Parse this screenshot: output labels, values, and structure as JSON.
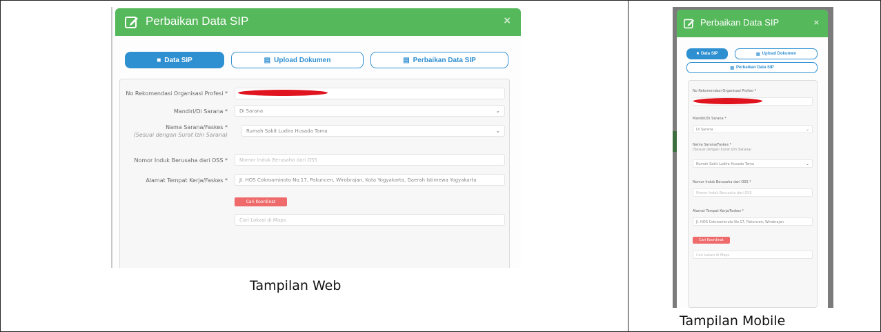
{
  "colors": {
    "header_green": "#55b85a",
    "tab_blue": "#2e8fd1",
    "map_button_red": "#ef6b6b",
    "redaction_red": "#e0141e"
  },
  "web": {
    "modal_title": "Perbaikan Data SIP",
    "close_icon": "×",
    "tabs": [
      {
        "label": "Data SIP",
        "icon": "user-icon",
        "active": true
      },
      {
        "label": "Upload Dokumen",
        "icon": "document-icon",
        "active": false
      },
      {
        "label": "Perbaikan Data SIP",
        "icon": "document-icon",
        "active": false
      }
    ],
    "fields": {
      "rekomendasi": {
        "label": "No Rekomendasi Organisasi Profesi *",
        "value": ""
      },
      "praktik": {
        "label": "Mandiri/Di Sarana *",
        "value": "Di Sarana"
      },
      "sarana": {
        "label": "Nama Sarana/Faskes *",
        "hint": "(Sesuai dengan Surat Izin Sarana)",
        "value": "Rumah Sakit Ludira Husada Tama"
      },
      "nib": {
        "label": "Nomor Induk Berusaha dari OSS *",
        "placeholder": "Nomor Induk Berusaha dari OSS"
      },
      "alamat": {
        "label": "Alamat Tempat Kerja/Faskes *",
        "value": "Jl. HOS Cokroaminoto No.17, Pakuncen, Wirobrajan, Kota Yogyakarta, Daerah Istimewa Yogyakarta"
      }
    },
    "map_button": "Cari Koordinat",
    "map_search_placeholder": "Cari Lokasi di Maps",
    "caption": "Tampilan Web"
  },
  "mobile": {
    "modal_title": "Perbaikan Data SIP",
    "close_icon": "×",
    "tabs": [
      {
        "label": "Data SIP",
        "icon": "user-icon",
        "active": true
      },
      {
        "label": "Upload Dokumen",
        "icon": "document-icon",
        "active": false
      },
      {
        "label": "Perbaikan Data SIP",
        "icon": "document-icon",
        "active": false
      }
    ],
    "fields": {
      "rekomendasi": {
        "label": "No Rekomendasi Organisasi Profesi *",
        "value": ""
      },
      "praktik": {
        "label": "Mandiri/Di Sarana *",
        "value": "Di Sarana"
      },
      "sarana": {
        "label": "Nama Sarana/Faskes *",
        "hint": "(Sesuai dengan Surat Izin Sarana)",
        "value": "Rumah Sakit Ludira Husada Tama"
      },
      "nib": {
        "label": "Nomor Induk Berusaha dari OSS *",
        "placeholder": "Nomor Induk Berusaha dari OSS"
      },
      "alamat": {
        "label": "Alamat Tempat Kerja/Faskes *",
        "value": "Jl. HOS Cokroaminoto No.17, Pakuncen, Wirobrajan"
      }
    },
    "map_button": "Cari Koordinat",
    "map_search_placeholder": "Cari Lokasi di Maps",
    "caption": "Tampilan Mobile"
  }
}
